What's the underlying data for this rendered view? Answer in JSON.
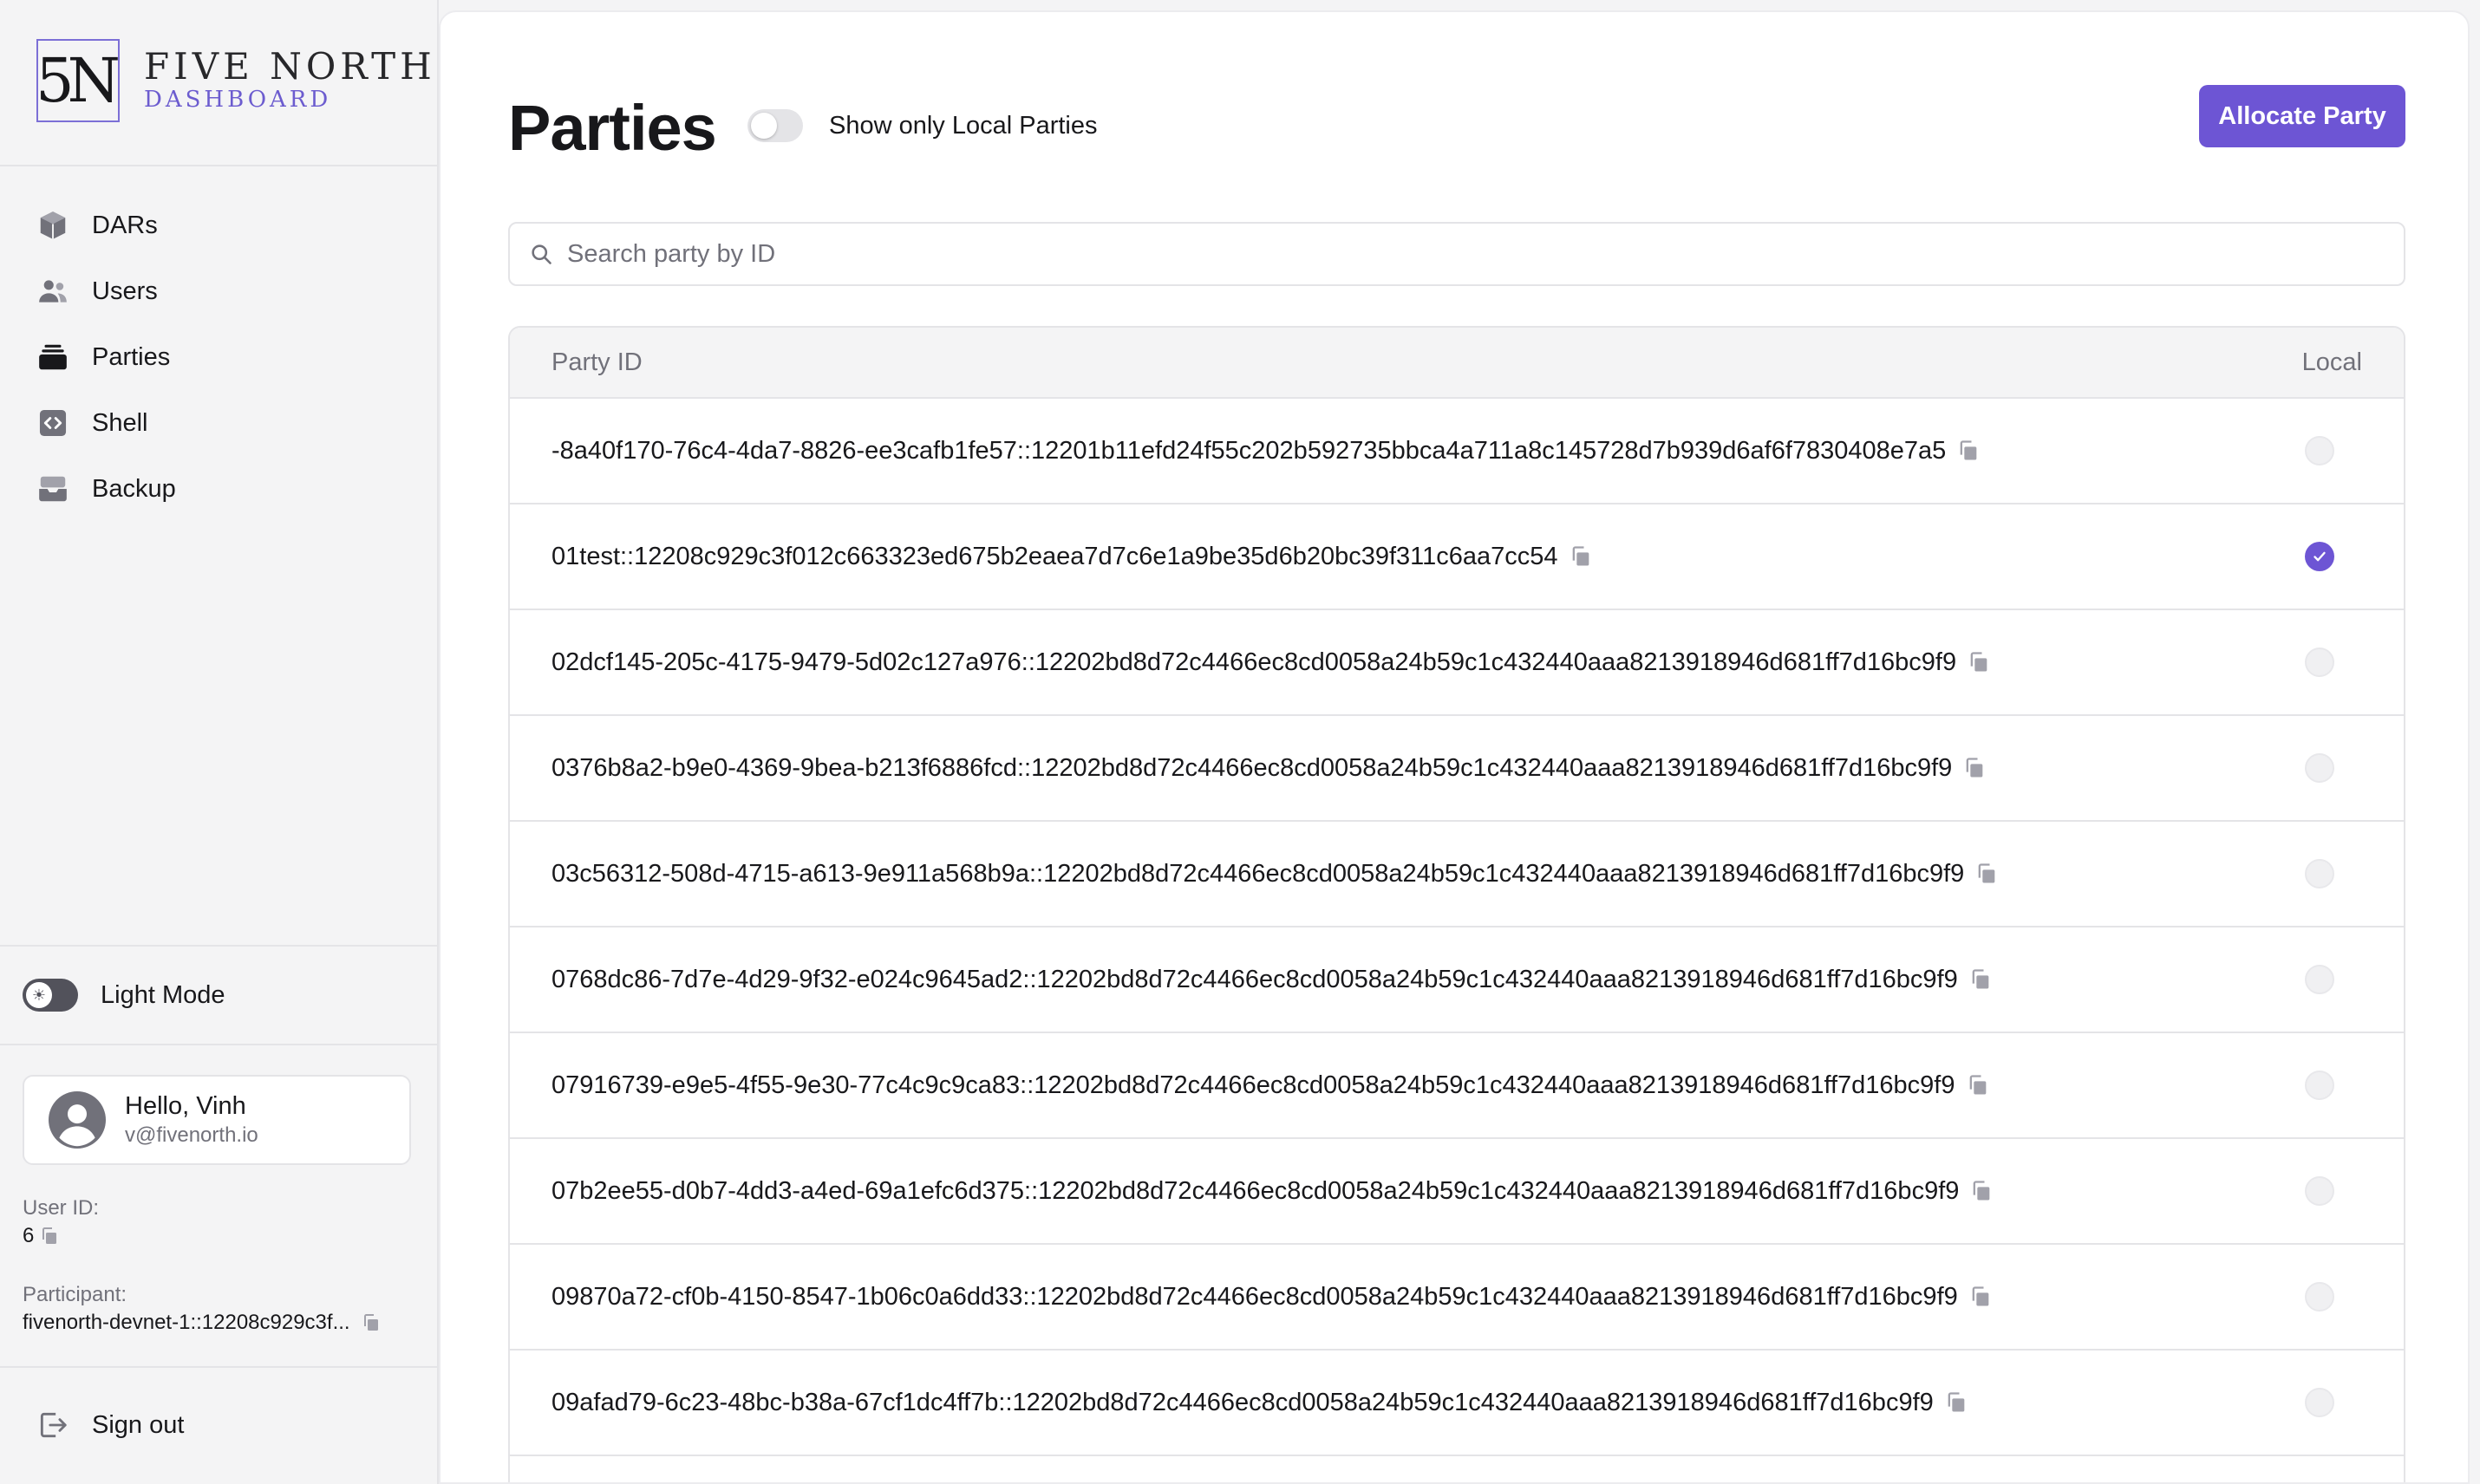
{
  "brand": {
    "mark": "5N",
    "name": "FIVE NORTH",
    "sub": "DASHBOARD"
  },
  "nav": [
    {
      "label": "DARs",
      "icon": "cube-icon"
    },
    {
      "label": "Users",
      "icon": "users-icon"
    },
    {
      "label": "Parties",
      "icon": "parties-icon"
    },
    {
      "label": "Shell",
      "icon": "shell-icon"
    },
    {
      "label": "Backup",
      "icon": "backup-icon"
    }
  ],
  "mode": {
    "label": "Light Mode"
  },
  "user": {
    "greeting": "Hello, Vinh",
    "email": "v@fivenorth.io",
    "id_label": "User ID:",
    "id_value": "6",
    "participant_label": "Participant:",
    "participant_value": "fivenorth-devnet-1::12208c929c3f..."
  },
  "signout": {
    "label": "Sign out"
  },
  "page": {
    "title": "Parties",
    "local_toggle_label": "Show only Local Parties",
    "allocate_button": "Allocate Party",
    "search_placeholder": "Search party by ID"
  },
  "table": {
    "columns": [
      "Party ID",
      "Local"
    ],
    "rows": [
      {
        "id": "-8a40f170-76c4-4da7-8826-ee3cafb1fe57::12201b11efd24f55c202b592735bbca4a711a8c145728d7b939d6af6f7830408e7a5",
        "local": false
      },
      {
        "id": "01test::12208c929c3f012c663323ed675b2eaea7d7c6e1a9be35d6b20bc39f311c6aa7cc54",
        "local": true
      },
      {
        "id": "02dcf145-205c-4175-9479-5d02c127a976::12202bd8d72c4466ec8cd0058a24b59c1c432440aaa8213918946d681ff7d16bc9f9",
        "local": false
      },
      {
        "id": "0376b8a2-b9e0-4369-9bea-b213f6886fcd::12202bd8d72c4466ec8cd0058a24b59c1c432440aaa8213918946d681ff7d16bc9f9",
        "local": false
      },
      {
        "id": "03c56312-508d-4715-a613-9e911a568b9a::12202bd8d72c4466ec8cd0058a24b59c1c432440aaa8213918946d681ff7d16bc9f9",
        "local": false
      },
      {
        "id": "0768dc86-7d7e-4d29-9f32-e024c9645ad2::12202bd8d72c4466ec8cd0058a24b59c1c432440aaa8213918946d681ff7d16bc9f9",
        "local": false
      },
      {
        "id": "07916739-e9e5-4f55-9e30-77c4c9c9ca83::12202bd8d72c4466ec8cd0058a24b59c1c432440aaa8213918946d681ff7d16bc9f9",
        "local": false
      },
      {
        "id": "07b2ee55-d0b7-4dd3-a4ed-69a1efc6d375::12202bd8d72c4466ec8cd0058a24b59c1c432440aaa8213918946d681ff7d16bc9f9",
        "local": false
      },
      {
        "id": "09870a72-cf0b-4150-8547-1b06c0a6dd33::12202bd8d72c4466ec8cd0058a24b59c1c432440aaa8213918946d681ff7d16bc9f9",
        "local": false
      },
      {
        "id": "09afad79-6c23-48bc-b38a-67cf1dc4ff7b::12202bd8d72c4466ec8cd0058a24b59c1c432440aaa8213918946d681ff7d16bc9f9",
        "local": false
      }
    ]
  },
  "colors": {
    "accent": "#6d55d4",
    "sidebar_bg": "#f4f4f5",
    "border": "#e4e4e7"
  }
}
